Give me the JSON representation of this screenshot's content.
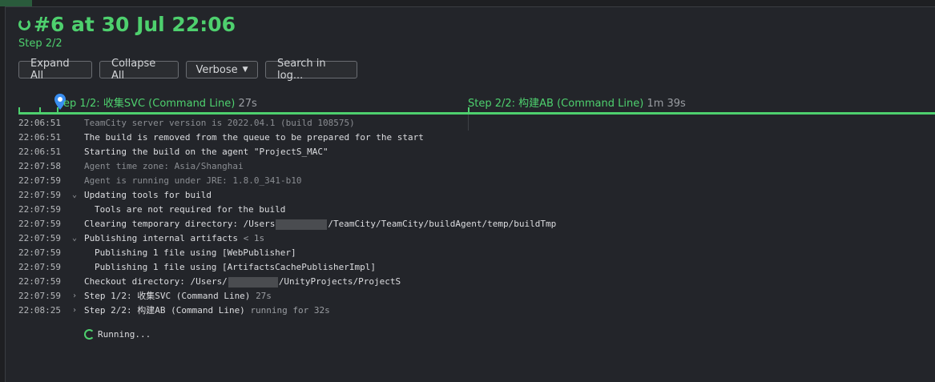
{
  "header": {
    "title": "#6 at 30 Jul 22:06",
    "step": "Step 2/2"
  },
  "toolbar": {
    "expand_all": "Expand All",
    "collapse_all": "Collapse All",
    "verbose": "Verbose",
    "search": "Search in log..."
  },
  "timeline": {
    "step1": {
      "name": "ep 1/2: 收集SVC (Command Line)",
      "duration": "27s"
    },
    "step2": {
      "name": "Step 2/2: 构建AB (Command Line)",
      "duration": "1m 39s"
    }
  },
  "log": [
    {
      "time": "22:06:51",
      "toggle": "",
      "text": "TeamCity server version is 2022.04.1 (build 108575)",
      "extra": ""
    },
    {
      "time": "22:06:51",
      "toggle": "",
      "text": "The build is removed from the queue to be prepared for the start",
      "extra": ""
    },
    {
      "time": "22:06:51",
      "toggle": "",
      "text": "Starting the build on the agent \"ProjectS_MAC\"",
      "extra": ""
    },
    {
      "time": "22:07:58",
      "toggle": "",
      "text": "Agent time zone: Asia/Shanghai",
      "extra": ""
    },
    {
      "time": "22:07:59",
      "toggle": "",
      "text": "Agent is running under JRE: 1.8.0_341-b10",
      "extra": ""
    },
    {
      "time": "22:07:59",
      "toggle": "⌄",
      "text": "Updating tools for build",
      "extra": ""
    },
    {
      "time": "22:07:59",
      "toggle": "",
      "text": "Tools are not required for the build",
      "extra": ""
    },
    {
      "time": "22:07:59",
      "toggle": "",
      "text": "Clearing temporary directory: /Users",
      "text2": "/TeamCity/TeamCity/buildAgent/temp/buildTmp",
      "extra": ""
    },
    {
      "time": "22:07:59",
      "toggle": "⌄",
      "text": "Publishing internal artifacts",
      "extra": "< 1s"
    },
    {
      "time": "22:07:59",
      "toggle": "",
      "text": "Publishing 1 file using [WebPublisher]",
      "extra": ""
    },
    {
      "time": "22:07:59",
      "toggle": "",
      "text": "Publishing 1 file using [ArtifactsCachePublisherImpl]",
      "extra": ""
    },
    {
      "time": "22:07:59",
      "toggle": "",
      "text": "Checkout directory: /Users/",
      "text2": "/UnityProjects/ProjectS",
      "extra": ""
    },
    {
      "time": "22:07:59",
      "toggle": "›",
      "text": "Step 1/2: 收集SVC (Command Line)",
      "extra": "27s"
    },
    {
      "time": "22:08:25",
      "toggle": "›",
      "text": "Step 2/2: 构建AB (Command Line)",
      "extra": "running for 32s"
    }
  ],
  "status": {
    "running": "Running..."
  },
  "colors": {
    "accent": "#4ed06e",
    "background": "#23252a"
  }
}
